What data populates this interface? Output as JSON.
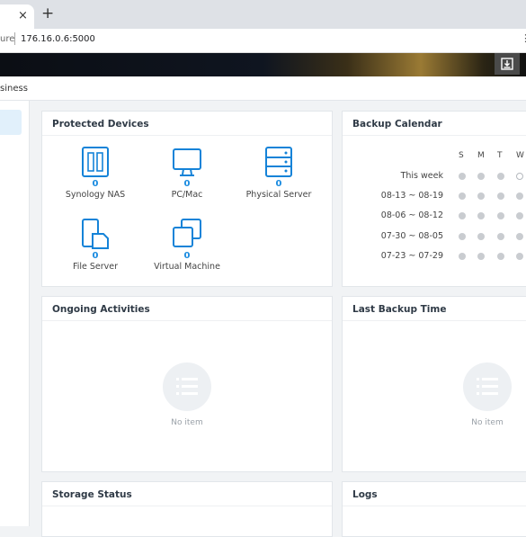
{
  "browser": {
    "tab_close": "×",
    "new_tab": "+",
    "security_text": "ure",
    "url": "176.16.0.6:5000",
    "more": "⋮"
  },
  "app": {
    "subtitle": "siness"
  },
  "protected_devices": {
    "title": "Protected Devices",
    "devices": [
      {
        "icon": "nas-icon",
        "count": "0",
        "label": "Synology NAS"
      },
      {
        "icon": "monitor-icon",
        "count": "0",
        "label": "PC/Mac"
      },
      {
        "icon": "server-icon",
        "count": "0",
        "label": "Physical Server"
      },
      {
        "icon": "file-server-icon",
        "count": "0",
        "label": "File Server"
      },
      {
        "icon": "virtual-machine-icon",
        "count": "0",
        "label": "Virtual Machine"
      }
    ]
  },
  "backup_calendar": {
    "title": "Backup Calendar",
    "days": [
      "S",
      "M",
      "T",
      "W"
    ],
    "rows": [
      {
        "label": "This week"
      },
      {
        "label": "08-13 ~ 08-19"
      },
      {
        "label": "08-06 ~ 08-12"
      },
      {
        "label": "07-30 ~ 08-05"
      },
      {
        "label": "07-23 ~ 07-29"
      }
    ]
  },
  "ongoing_activities": {
    "title": "Ongoing Activities",
    "empty_label": "No item"
  },
  "last_backup_time": {
    "title": "Last Backup Time",
    "empty_label": "No item"
  },
  "storage_status": {
    "title": "Storage Status"
  },
  "logs": {
    "title": "Logs"
  },
  "colors": {
    "accent": "#1a8be0",
    "icon_blue": "#1583d8",
    "dot_gray": "#c9ccd0"
  }
}
